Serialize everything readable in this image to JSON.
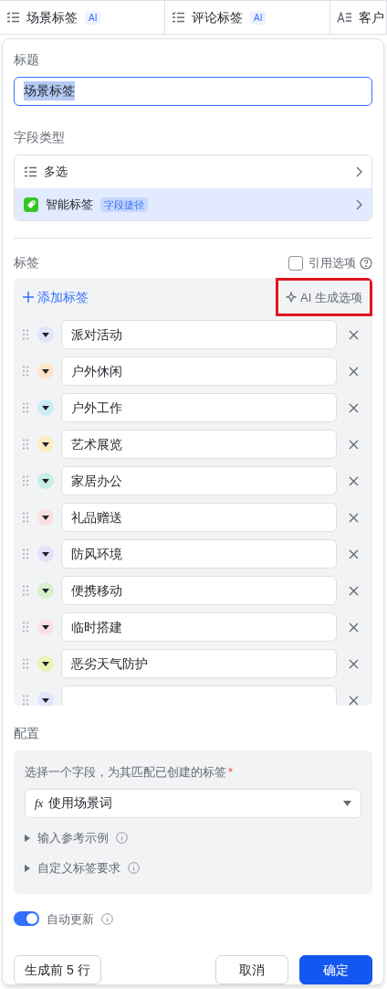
{
  "columns": [
    {
      "kind": "multi",
      "label": "场景标签",
      "badge": "AI"
    },
    {
      "kind": "multi",
      "label": "评论标签",
      "badge": "AI"
    },
    {
      "kind": "text",
      "label": "客户"
    }
  ],
  "title_field": {
    "label": "标题",
    "value": "场景标签"
  },
  "field_type": {
    "label": "字段类型",
    "options": [
      {
        "kind": "multi",
        "label": "多选",
        "selected": false
      },
      {
        "kind": "smart",
        "label": "智能标签",
        "tag": "字段捷径",
        "selected": true
      }
    ]
  },
  "tags": {
    "label": "标签",
    "reference": {
      "label": "引用选项",
      "checked": false
    },
    "add_button": "添加标签",
    "ai_button": {
      "label": "AI 生成选项",
      "highlighted": true
    },
    "items": [
      {
        "label": "派对活动",
        "color": "#e2e4fb"
      },
      {
        "label": "户外休闲",
        "color": "#fde3c8"
      },
      {
        "label": "户外工作",
        "color": "#cdebf9"
      },
      {
        "label": "艺术展览",
        "color": "#fcecc2"
      },
      {
        "label": "家居办公",
        "color": "#c8eee6"
      },
      {
        "label": "礼品赠送",
        "color": "#fbdede"
      },
      {
        "label": "防风环境",
        "color": "#e6e0fa"
      },
      {
        "label": "便携移动",
        "color": "#d5f1cc"
      },
      {
        "label": "临时搭建",
        "color": "#fbe0ea"
      },
      {
        "label": "恶劣天气防护",
        "color": "#edf3b3"
      },
      {
        "color": "#e2e4fb"
      }
    ]
  },
  "config": {
    "label": "配置",
    "field_label": "选择一个字段，为其匹配已创建的标签",
    "required_mark": "*",
    "select": {
      "icon": "fx",
      "value": "使用场景词"
    },
    "sections": [
      {
        "label": "输入参考示例",
        "expanded": false
      },
      {
        "label": "自定义标签要求",
        "expanded": false
      }
    ]
  },
  "auto_update": {
    "label": "自动更新",
    "on": true
  },
  "buttons": [
    {
      "kind": "secondary",
      "label": "生成前 5 行"
    },
    {
      "kind": "default",
      "label": "取消"
    },
    {
      "kind": "primary",
      "label": "确定"
    }
  ]
}
